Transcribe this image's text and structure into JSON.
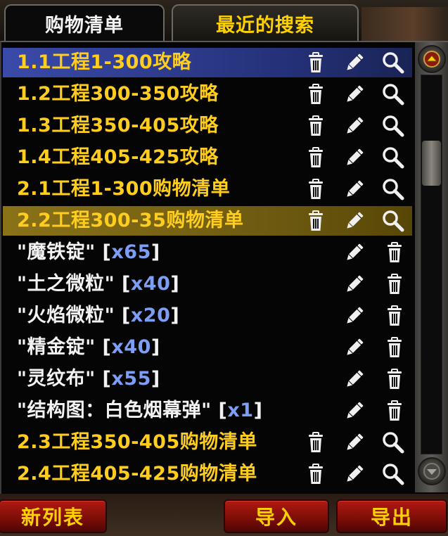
{
  "tabs": [
    {
      "label": "购物清单",
      "active": true
    },
    {
      "label": "最近的搜索",
      "active": false
    }
  ],
  "rows": [
    {
      "kind": "guide",
      "label": "1.1工程1-300攻略",
      "color": "gold",
      "highlight": "blue"
    },
    {
      "kind": "guide",
      "label": "1.2工程300-350攻略",
      "color": "gold"
    },
    {
      "kind": "guide",
      "label": "1.3工程350-405攻略",
      "color": "gold"
    },
    {
      "kind": "guide",
      "label": "1.4工程405-425攻略",
      "color": "gold"
    },
    {
      "kind": "guide",
      "label": "2.1工程1-300购物清单",
      "color": "gold"
    },
    {
      "kind": "guide",
      "label": "2.2工程300-35购物清单",
      "color": "gold",
      "highlight": "gold"
    },
    {
      "kind": "item",
      "name": "\"魔铁锭\"",
      "qty": "[x65]",
      "color": "white"
    },
    {
      "kind": "item",
      "name": "\"土之微粒\"",
      "qty": "[x40]",
      "color": "white"
    },
    {
      "kind": "item",
      "name": "\"火焰微粒\"",
      "qty": "[x20]",
      "color": "white"
    },
    {
      "kind": "item",
      "name": "\"精金锭\"",
      "qty": "[x40]",
      "color": "white"
    },
    {
      "kind": "item",
      "name": "\"灵纹布\"",
      "qty": "[x55]",
      "color": "white"
    },
    {
      "kind": "item",
      "name": "\"结构图：白色烟幕弹\"",
      "qty": "[x1]",
      "color": "white"
    },
    {
      "kind": "guide",
      "label": "2.3工程350-405购物清单",
      "color": "gold"
    },
    {
      "kind": "guide",
      "label": "2.4工程405-425购物清单",
      "color": "gold"
    }
  ],
  "buttons": {
    "new_list": "新列表",
    "import": "导入",
    "export": "导出"
  },
  "icons": {
    "guide_row": [
      "trash-icon",
      "pencil-icon",
      "magnifier-icon"
    ],
    "item_row": [
      "pencil-icon",
      "trash-icon"
    ],
    "scroll_up": "arrow-up-icon",
    "scroll_down": "arrow-down-icon"
  },
  "colors": {
    "gold_text": "#ffcd1e",
    "white_text": "#f2f2f2",
    "qty_text": "#7d9ef5",
    "selected_blue": "#3a4aa8",
    "selected_gold": "#8a7218",
    "button_red": "#b01a12",
    "button_text": "#ffd100"
  }
}
